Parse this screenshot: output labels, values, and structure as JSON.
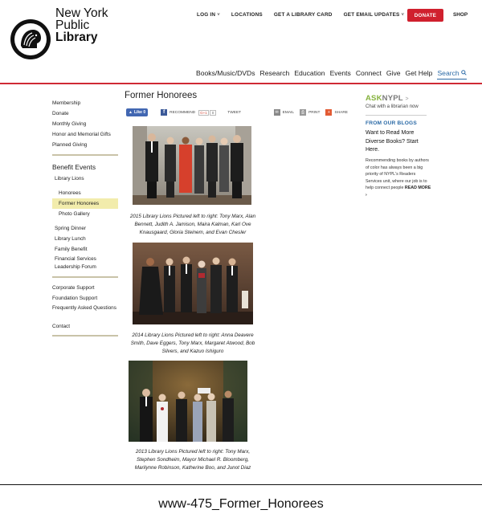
{
  "brand": {
    "line1": "New York",
    "line2": "Public",
    "line3": "Library"
  },
  "topnav": {
    "login": "LOG IN",
    "locations": "LOCATIONS",
    "library_card": "GET A LIBRARY CARD",
    "email_updates": "GET EMAIL UPDATES",
    "donate": "DONATE",
    "shop": "SHOP",
    "chevron": "˅"
  },
  "mainnav": {
    "items": [
      "Books/Music/DVDs",
      "Research",
      "Education",
      "Events",
      "Connect",
      "Give",
      "Get Help"
    ],
    "search": "Search"
  },
  "sidebar": {
    "group1": [
      "Membership",
      "Donate",
      "Monthly Giving",
      "Honor and Memorial Gifts",
      "Planned Giving"
    ],
    "benefit_events": "Benefit Events",
    "library_lions": "Library Lions",
    "lions_sub": [
      "Honorees",
      "Former Honorees",
      "Photo Gallery"
    ],
    "events": [
      "Spring Dinner",
      "Library Lunch",
      "Family Benefit",
      "Financial Services Leadership Forum"
    ],
    "group3": [
      "Corporate Support",
      "Foundation Support",
      "Frequently Asked Questions",
      "Contact"
    ]
  },
  "content": {
    "title": "Former Honorees",
    "share": {
      "like": "Like 0",
      "recommend": "RECOMMEND",
      "gplus": "G+1",
      "gcount": "0",
      "tweet": "TWEET",
      "email": "EMAIL",
      "print": "PRINT",
      "share": "SHARE"
    },
    "captions": [
      "2015 Library Lions Pictured left to right: Tony Marx, Alan Bennett, Judith A. Jamison, Maira Kalman, Karl Ove Knausgaard, Gloria Steinem, and Evan Chesler",
      "2014 Library Lions Pictured left to right: Anna Deavere Smith, Dave Eggers, Tony Marx, Margaret Atwood, Bob Silvers, and Kazuo Ishiguro",
      "2013 Library Lions Pictured left to right: Tony Marx, Stephen Sondheim, Mayor Michael R. Bloomberg, Marilynne Robinson, Katherine Boo, and Junot Diaz"
    ]
  },
  "right": {
    "ask_a": "ASK",
    "ask_n": "NYPL",
    "ask_arrow": ">",
    "ask_sub": "Chat with a librarian now",
    "blogs_head": "FROM OUR BLOGS",
    "blog_title": "Want to Read More Diverse Books? Start Here.",
    "blog_body": "Recommending books by authors of color has always been a big priority of NYPL's Readers Services unit, where our job is to help connect people",
    "read_more": "READ MORE ›"
  },
  "footer_label": "www-475_Former_Honorees",
  "colors": {
    "red": "#d0202e",
    "link_blue": "#2b6aa6",
    "ask_green": "#86b23e",
    "active_highlight": "#f2ecac"
  }
}
